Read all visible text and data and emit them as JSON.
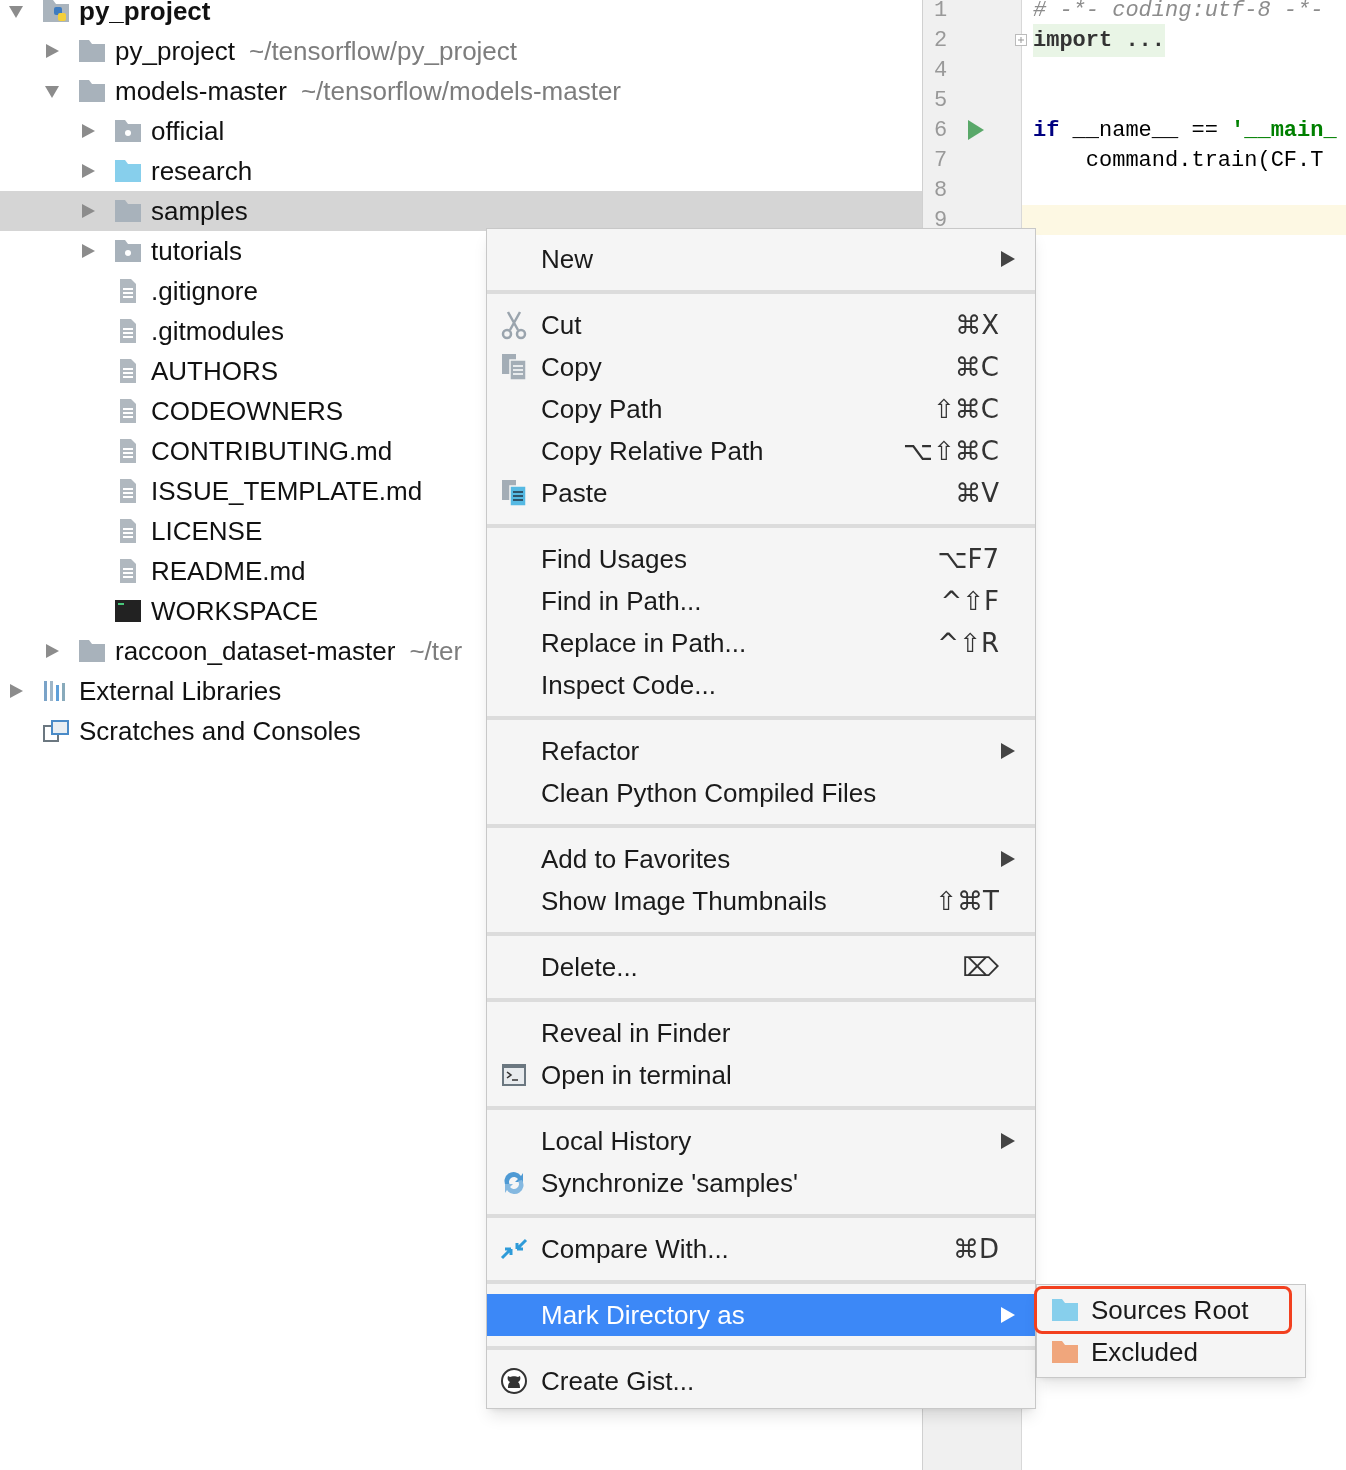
{
  "project_tree": [
    {
      "label": "py_project",
      "kind": "project",
      "expanded": true,
      "selected": false,
      "children": [
        {
          "label": "py_project",
          "path": "~/tensorflow/py_project",
          "kind": "folder",
          "expanded": false,
          "selected": false
        },
        {
          "label": "models-master",
          "path": "~/tensorflow/models-master",
          "kind": "folder",
          "expanded": true,
          "selected": false,
          "children": [
            {
              "label": "official",
              "kind": "package",
              "expanded": false,
              "selected": false
            },
            {
              "label": "research",
              "kind": "source",
              "expanded": false,
              "selected": false
            },
            {
              "label": "samples",
              "kind": "folder",
              "expanded": false,
              "selected": true
            },
            {
              "label": "tutorials",
              "kind": "package",
              "expanded": false,
              "selected": false
            },
            {
              "label": ".gitignore",
              "kind": "file",
              "selected": false
            },
            {
              "label": ".gitmodules",
              "kind": "file",
              "selected": false
            },
            {
              "label": "AUTHORS",
              "kind": "file",
              "selected": false
            },
            {
              "label": "CODEOWNERS",
              "kind": "file",
              "selected": false
            },
            {
              "label": "CONTRIBUTING.md",
              "kind": "file",
              "selected": false
            },
            {
              "label": "ISSUE_TEMPLATE.md",
              "kind": "file",
              "selected": false
            },
            {
              "label": "LICENSE",
              "kind": "file",
              "selected": false
            },
            {
              "label": "README.md",
              "kind": "file",
              "selected": false
            },
            {
              "label": "WORKSPACE",
              "kind": "console",
              "selected": false
            }
          ]
        },
        {
          "label": "raccoon_dataset-master",
          "path": "~/ter",
          "kind": "folder",
          "expanded": false,
          "selected": false
        }
      ]
    },
    {
      "label": "External Libraries",
      "kind": "libraries",
      "expanded": false,
      "selected": false
    },
    {
      "label": "Scratches and Consoles",
      "kind": "scratches",
      "selected": false
    }
  ],
  "editor": {
    "lines": [
      {
        "number": "1",
        "tokens": [
          {
            "kind": "comment",
            "text": "# -*- coding:utf-8 -*-"
          }
        ]
      },
      {
        "number": "2",
        "folded": true,
        "tokens": [
          {
            "kind": "folded",
            "text": "import ..."
          }
        ]
      },
      {
        "number": "4"
      },
      {
        "number": "5"
      },
      {
        "number": "6",
        "runnable": true,
        "tokens": [
          {
            "kind": "keyword",
            "text": "if"
          },
          {
            "kind": "plain",
            "text": " __name__ == "
          },
          {
            "kind": "string",
            "text": "'__main_"
          }
        ]
      },
      {
        "number": "7",
        "tokens": [
          {
            "kind": "plain",
            "text": "    command.train(CF.T"
          }
        ]
      },
      {
        "number": "8"
      },
      {
        "number": "9",
        "current": true
      }
    ]
  },
  "context_menu": {
    "sections": [
      [
        {
          "label": "New",
          "submenu": true,
          "selected": false
        }
      ],
      [
        {
          "label": "Cut",
          "kind": "cut",
          "shortcut": "⌘X",
          "submenu": false,
          "selected": false
        },
        {
          "label": "Copy",
          "kind": "copy",
          "shortcut": "⌘C",
          "submenu": false,
          "selected": false
        },
        {
          "label": "Copy Path",
          "shortcut": "⇧⌘C",
          "submenu": false,
          "selected": false
        },
        {
          "label": "Copy Relative Path",
          "shortcut": "⌥⇧⌘C",
          "submenu": false,
          "selected": false
        },
        {
          "label": "Paste",
          "kind": "paste",
          "shortcut": "⌘V",
          "submenu": false,
          "selected": false
        }
      ],
      [
        {
          "label": "Find Usages",
          "shortcut": "⌥F7",
          "submenu": false,
          "selected": false
        },
        {
          "label": "Find in Path...",
          "shortcut": "^⇧F",
          "submenu": false,
          "selected": false
        },
        {
          "label": "Replace in Path...",
          "shortcut": "^⇧R",
          "submenu": false,
          "selected": false
        },
        {
          "label": "Inspect Code...",
          "submenu": false,
          "selected": false
        }
      ],
      [
        {
          "label": "Refactor",
          "submenu": true,
          "selected": false
        },
        {
          "label": "Clean Python Compiled Files",
          "submenu": false,
          "selected": false
        }
      ],
      [
        {
          "label": "Add to Favorites",
          "submenu": true,
          "selected": false
        },
        {
          "label": "Show Image Thumbnails",
          "shortcut": "⇧⌘T",
          "submenu": false,
          "selected": false
        }
      ],
      [
        {
          "label": "Delete...",
          "shortcut": "⌦",
          "submenu": false,
          "selected": false
        }
      ],
      [
        {
          "label": "Reveal in Finder",
          "submenu": false,
          "selected": false
        },
        {
          "label": "Open in terminal",
          "kind": "terminal",
          "submenu": false,
          "selected": false
        }
      ],
      [
        {
          "label": "Local History",
          "submenu": true,
          "selected": false
        },
        {
          "label": "Synchronize 'samples'",
          "kind": "sync",
          "submenu": false,
          "selected": false
        }
      ],
      [
        {
          "label": "Compare With...",
          "kind": "compare",
          "shortcut": "⌘D",
          "submenu": false,
          "selected": false
        }
      ],
      [
        {
          "label": "Mark Directory as",
          "submenu": true,
          "selected": true
        }
      ],
      [
        {
          "label": "Create Gist...",
          "kind": "github",
          "submenu": false,
          "selected": false
        }
      ]
    ]
  },
  "submenu": {
    "items": [
      {
        "label": "Sources Root",
        "kind": "source",
        "outlined": true
      },
      {
        "label": "Excluded",
        "kind": "excluded",
        "outlined": false
      }
    ]
  }
}
